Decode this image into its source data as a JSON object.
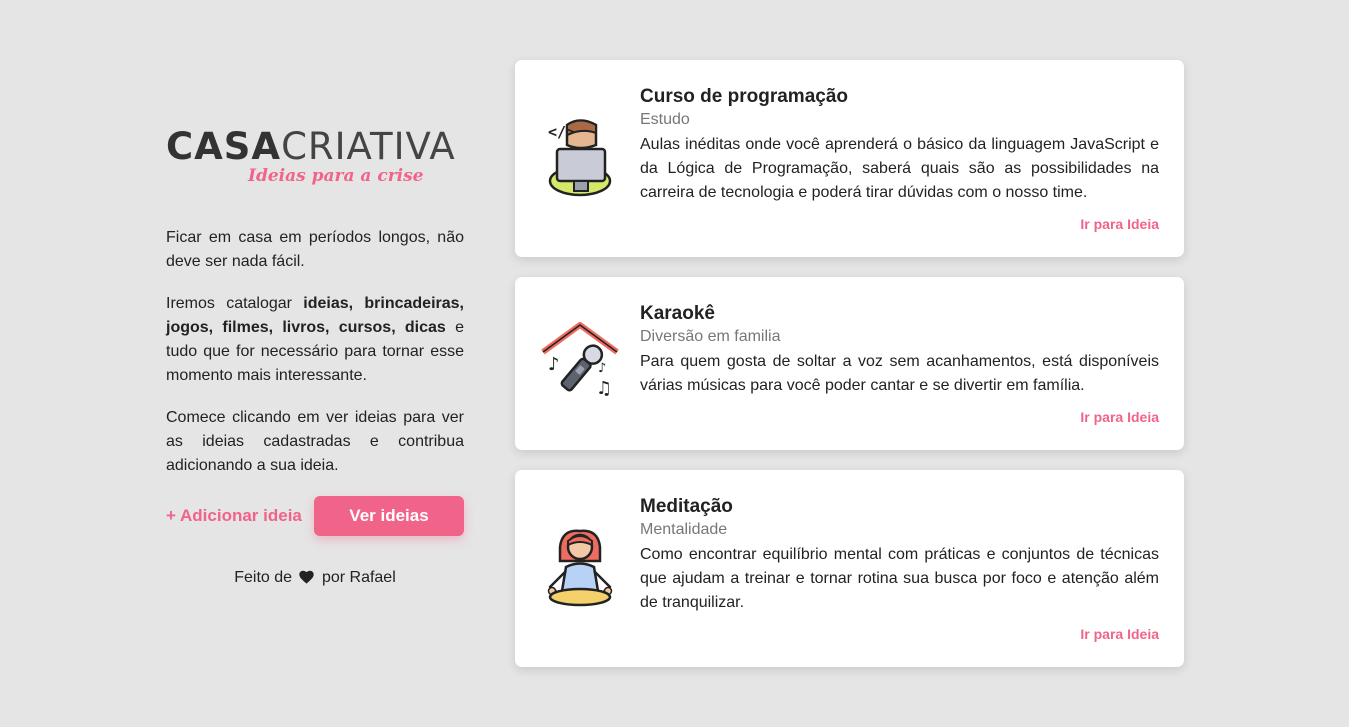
{
  "brand": {
    "logo_bold": "CASA",
    "logo_light": "CRIATIVA",
    "tagline": "Ideias para a crise"
  },
  "intro": {
    "p1": "Ficar em casa em períodos longos, não deve ser nada fácil.",
    "p2_before": "Iremos catalogar ",
    "p2_bold": "ideias, brincadeiras, jogos, filmes, livros, cursos, dicas",
    "p2_after": " e tudo que for necessário para tornar esse momento mais interessante.",
    "p3": "Comece clicando em ver ideias para ver as ideias cadastradas e contribua adicionando a sua ideia."
  },
  "actions": {
    "add_label": "+ Adicionar ideia",
    "view_label": "Ver ideias"
  },
  "footer": {
    "before": "Feito de",
    "after": "por Rafael"
  },
  "colors": {
    "accent": "#f1648a",
    "background": "#e5e5e5",
    "card": "#ffffff"
  },
  "cards": [
    {
      "icon": "programmer-icon",
      "title": "Curso de programação",
      "category": "Estudo",
      "description": "Aulas inéditas onde você aprenderá o básico da linguagem JavaScript e da Lógica de Programação, saberá quais são as possibilidades na carreira de tecnologia e poderá tirar dúvidas com o nosso time.",
      "link": "Ir para Ideia"
    },
    {
      "icon": "karaoke-icon",
      "title": "Karaokê",
      "category": "Diversão em familia",
      "description": "Para quem gosta de soltar a voz sem acanhamentos, está disponíveis várias músicas para você poder cantar e se divertir em família.",
      "link": "Ir para Ideia"
    },
    {
      "icon": "meditation-icon",
      "title": "Meditação",
      "category": "Mentalidade",
      "description": "Como encontrar equilíbrio mental com práticas e conjuntos de técnicas que ajudam a treinar e tornar rotina sua busca por foco e atenção além de tranquilizar.",
      "link": "Ir para Ideia"
    }
  ]
}
